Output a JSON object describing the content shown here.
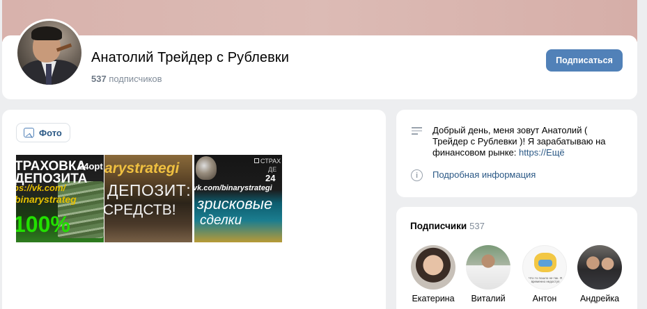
{
  "header": {
    "title": "Анатолий Трейдер с Рублевки",
    "subscribers_count": "537",
    "subscribers_label": "подписчиков",
    "subscribe_label": "Подписаться"
  },
  "photos": {
    "button_label": "Фото",
    "thumbs": [
      {
        "lines": [
          "ТРАХОВКА",
          "24opt",
          "ДЕПОЗИТА",
          "ps://vk.com/",
          "binarystrateg",
          "100%"
        ]
      },
      {
        "lines": [
          "arystrategi",
          "ДЕПОЗИТ:",
          "СРЕДСТВ!"
        ]
      },
      {
        "lines": [
          "СТРАХ",
          "ДЕ",
          "24",
          "vk.com/binarystrategi",
          "зрисковые",
          "сделки"
        ]
      }
    ]
  },
  "info": {
    "description": "Добрый день, меня зовут Анатолий ( Трейдер с Рублевки )! Я зарабатываю на финансовом рынке: ",
    "description_link": "https://Ещё",
    "more_label": "Подробная информация"
  },
  "followers": {
    "title": "Подписчики",
    "count": "537",
    "items": [
      {
        "name": "Екатерина"
      },
      {
        "name": "Виталий"
      },
      {
        "name": "Антон"
      },
      {
        "name": "Андрейка"
      }
    ],
    "anton_caption": "Что то пошло не так. Я временно недоступ"
  },
  "colors": {
    "accent": "#5181b8",
    "link": "#2a5885",
    "page_bg": "#edeef0",
    "cover": "#d8b2ac"
  }
}
